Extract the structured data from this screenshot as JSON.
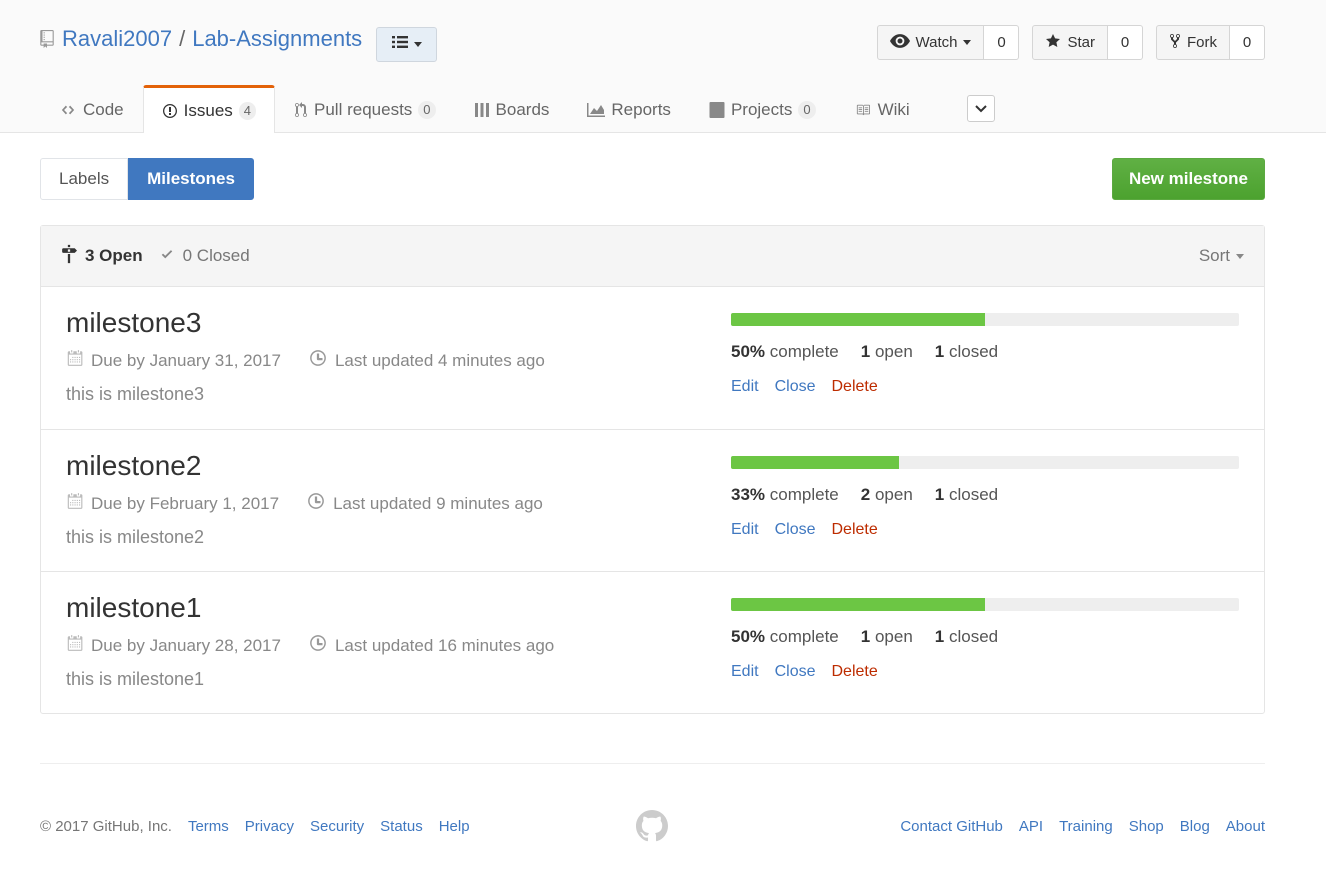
{
  "repo": {
    "owner": "Ravali2007",
    "separator": "/",
    "name": "Lab-Assignments"
  },
  "actions": {
    "watch_label": "Watch",
    "watch_count": "0",
    "star_label": "Star",
    "star_count": "0",
    "fork_label": "Fork",
    "fork_count": "0"
  },
  "nav": {
    "code": "Code",
    "issues": "Issues",
    "issues_count": "4",
    "pulls": "Pull requests",
    "pulls_count": "0",
    "boards": "Boards",
    "reports": "Reports",
    "projects": "Projects",
    "projects_count": "0",
    "wiki": "Wiki"
  },
  "subnav": {
    "labels": "Labels",
    "milestones": "Milestones",
    "new_milestone": "New milestone"
  },
  "list_header": {
    "open": "3 Open",
    "closed": "0 Closed",
    "sort": "Sort"
  },
  "milestones": [
    {
      "title": "milestone3",
      "due": "Due by January 31, 2017",
      "updated": "Last updated 4 minutes ago",
      "description": "this is milestone3",
      "percent": "50%",
      "percent_value": 50,
      "complete_label": "complete",
      "open": "1",
      "open_label": "open",
      "closed": "1",
      "closed_label": "closed",
      "edit": "Edit",
      "close": "Close",
      "delete": "Delete"
    },
    {
      "title": "milestone2",
      "due": "Due by February 1, 2017",
      "updated": "Last updated 9 minutes ago",
      "description": "this is milestone2",
      "percent": "33%",
      "percent_value": 33,
      "complete_label": "complete",
      "open": "2",
      "open_label": "open",
      "closed": "1",
      "closed_label": "closed",
      "edit": "Edit",
      "close": "Close",
      "delete": "Delete"
    },
    {
      "title": "milestone1",
      "due": "Due by January 28, 2017",
      "updated": "Last updated 16 minutes ago",
      "description": "this is milestone1",
      "percent": "50%",
      "percent_value": 50,
      "complete_label": "complete",
      "open": "1",
      "open_label": "open",
      "closed": "1",
      "closed_label": "closed",
      "edit": "Edit",
      "close": "Close",
      "delete": "Delete"
    }
  ],
  "footer": {
    "copyright": "© 2017 GitHub, Inc.",
    "left_links": [
      "Terms",
      "Privacy",
      "Security",
      "Status",
      "Help"
    ],
    "right_links": [
      "Contact GitHub",
      "API",
      "Training",
      "Shop",
      "Blog",
      "About"
    ]
  },
  "colors": {
    "link": "#4078c0",
    "progress": "#6cc644",
    "primary_button": "#60b044",
    "delete": "#bd2c00",
    "selected_tab_accent": "#e36209"
  }
}
